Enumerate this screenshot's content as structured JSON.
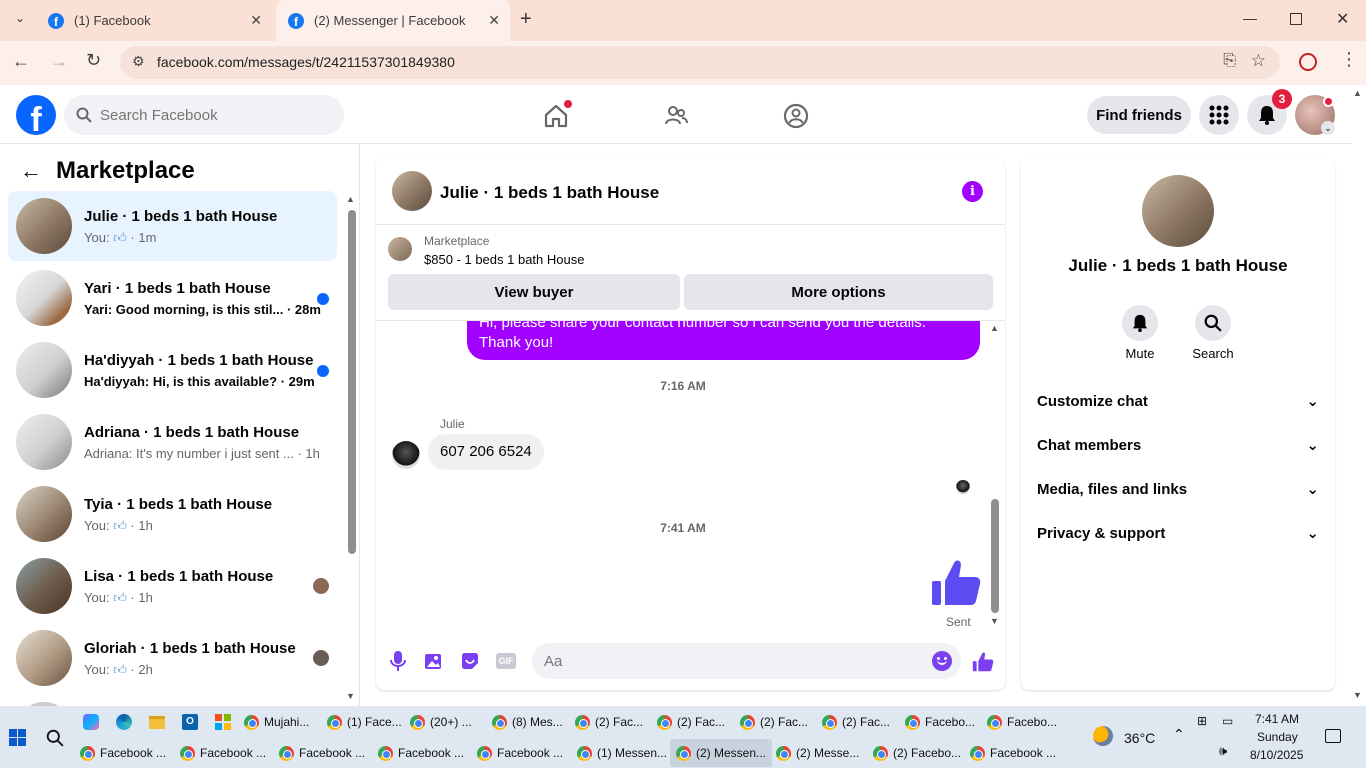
{
  "browser": {
    "tabs": [
      {
        "title": "(1) Facebook",
        "active": false
      },
      {
        "title": "(2) Messenger | Facebook",
        "active": true
      }
    ],
    "url": "facebook.com/messages/t/24211537301849380"
  },
  "header": {
    "search_placeholder": "Search Facebook",
    "find_friends": "Find friends",
    "notifications_count": "3"
  },
  "left": {
    "title": "Marketplace",
    "conversations": [
      {
        "name": "Julie · 1 beds 1 bath House",
        "preview_prefix": "You:",
        "time": "· 1m",
        "liked": true,
        "selected": true
      },
      {
        "name": "Yari · 1 beds 1 bath House",
        "preview": "Yari: Good morning, is this stil...",
        "time": "· 28m",
        "unread": true
      },
      {
        "name": "Ha'diyyah · 1 beds 1 bath House",
        "preview": "Ha'diyyah: Hi, is this available?",
        "time": "· 29m",
        "unread": true
      },
      {
        "name": "Adriana · 1 beds 1 bath House",
        "preview": "Adriana: It's my number i just sent ...",
        "time": "· 1h"
      },
      {
        "name": "Tyia · 1 beds 1 bath House",
        "preview_prefix": "You:",
        "time": "· 1h",
        "liked": true
      },
      {
        "name": "Lisa · 1 beds 1 bath House",
        "preview_prefix": "You:",
        "time": "· 1h",
        "liked": true,
        "seen": true
      },
      {
        "name": "Gloriah · 1 beds 1 bath House",
        "preview_prefix": "You:",
        "time": "· 2h",
        "liked": true,
        "seen": true
      }
    ]
  },
  "chat": {
    "title": "Julie · 1 beds 1 bath House",
    "listing_source": "Marketplace",
    "listing": "$850 - 1 beds 1 bath House",
    "view_buyer": "View buyer",
    "more_options": "More options",
    "outgoing_message": "Hi, please share your contact number so i can send you the details. Thank you!",
    "time1": "7:16 AM",
    "sender": "Julie",
    "incoming_message": "607 206 6524",
    "time2": "7:41 AM",
    "sent_label": "Sent",
    "composer_placeholder": "Aa"
  },
  "info": {
    "title": "Julie · 1 beds 1 bath House",
    "mute": "Mute",
    "search": "Search",
    "sections": [
      "Customize chat",
      "Chat members",
      "Media, files and links",
      "Privacy & support"
    ]
  },
  "taskbar": {
    "row1": [
      "Mujahi...",
      "(1) Face...",
      "(20+) ...",
      "(8) Mes...",
      "(2) Fac...",
      "(2) Fac...",
      "(2) Fac...",
      "(2) Fac...",
      "Facebo...",
      "Facebo..."
    ],
    "row2": [
      "Facebook ...",
      "Facebook ...",
      "Facebook ...",
      "Facebook ...",
      "Facebook ...",
      "(1) Messen...",
      "(2) Messen...",
      "(2) Messe...",
      "(2) Facebo...",
      "Facebook ..."
    ],
    "weather": "36°C",
    "time": "7:41 AM",
    "day": "Sunday",
    "date": "8/10/2025"
  }
}
